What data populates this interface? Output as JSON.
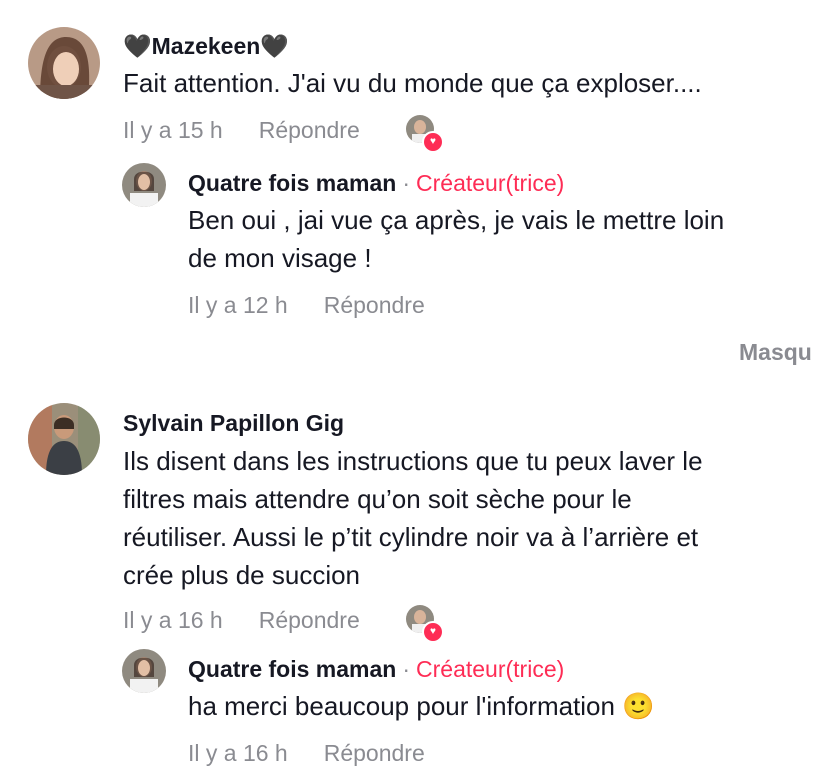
{
  "comments": [
    {
      "author": "🖤Mazekeen🖤",
      "text_lines": [
        "Fait attention. J'ai vu du monde que ça exploser...."
      ],
      "time": "Il y a 15 h",
      "reply_label": "Répondre",
      "reply": {
        "author": "Quatre fois maman",
        "separator": "·",
        "creator_label": "Créateur(trice)",
        "text_lines": [
          "Ben oui , jai vue ça après, je vais le mettre loin",
          "de mon visage !"
        ],
        "time": "Il y a 12 h",
        "reply_label": "Répondre"
      },
      "hide_label": "Masqu"
    },
    {
      "author": "Sylvain Papillon Gig",
      "text_lines": [
        "Ils disent dans les instructions que tu peux laver le",
        "filtres mais attendre qu’on soit sèche pour le",
        "réutiliser. Aussi le p’tit cylindre noir va à l’arrière et",
        "crée plus de succion"
      ],
      "time": "Il y a 16 h",
      "reply_label": "Répondre",
      "reply": {
        "author": "Quatre fois maman",
        "separator": "·",
        "creator_label": "Créateur(trice)",
        "text_lines": [
          "ha merci beaucoup pour l'information 🙂"
        ],
        "time": "Il y a 16 h",
        "reply_label": "Répondre"
      }
    }
  ],
  "colors": {
    "text": "#161823",
    "secondary": "#8a8b91",
    "creator": "#fe2c55"
  }
}
